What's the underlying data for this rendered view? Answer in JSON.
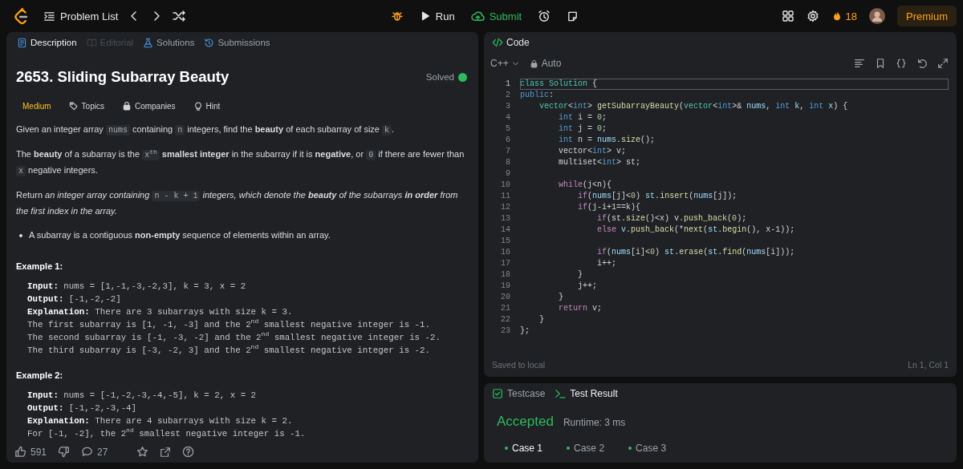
{
  "topbar": {
    "problem_list": "Problem List",
    "run": "Run",
    "submit": "Submit",
    "streak": "18",
    "premium": "Premium"
  },
  "description_tabs": [
    {
      "label": "Description",
      "selected": true,
      "disabled": false
    },
    {
      "label": "Editorial",
      "selected": false,
      "disabled": true
    },
    {
      "label": "Solutions",
      "selected": false,
      "disabled": false
    },
    {
      "label": "Submissions",
      "selected": false,
      "disabled": false
    }
  ],
  "problem": {
    "title": "2653. Sliding Subarray Beauty",
    "status": "Solved",
    "difficulty": "Medium",
    "tags": [
      "Topics",
      "Companies",
      "Hint"
    ],
    "paragraphs": [
      [
        {
          "kind": "text",
          "text": "Given an integer array "
        },
        {
          "kind": "code",
          "text": "nums"
        },
        {
          "kind": "text",
          "text": " containing "
        },
        {
          "kind": "code",
          "text": "n"
        },
        {
          "kind": "text",
          "text": " integers, find the **beauty** of each subarray of size "
        },
        {
          "kind": "code",
          "text": "k"
        },
        {
          "kind": "text",
          "text": "."
        }
      ],
      [
        {
          "kind": "text",
          "text": "The **beauty** of a subarray is the "
        },
        {
          "kind": "code",
          "text": "x$^{th}$"
        },
        {
          "kind": "text",
          "text": " **smallest integer** in the subarray if it is **negative**, or "
        },
        {
          "kind": "code",
          "text": "0"
        },
        {
          "kind": "text",
          "text": " if there are fewer than "
        },
        {
          "kind": "code",
          "text": "x"
        },
        {
          "kind": "text",
          "text": " negative integers."
        }
      ],
      [
        {
          "kind": "text",
          "text": "Return "
        },
        {
          "kind": "em",
          "text": "an integer array containing "
        },
        {
          "kind": "code",
          "text": "n - k + 1"
        },
        {
          "kind": "em",
          "text": " integers, which denote the **beauty** of the subarrays **in order** from the first index in the array."
        }
      ]
    ],
    "bullets": [
      "A subarray is a contiguous **non-empty** sequence of elements within an array."
    ],
    "examples": [
      {
        "title": "Example 1:",
        "lines": [
          "**Input:** nums = [1,-1,-3,-2,3], k = 3, x = 2",
          "**Output:** [-1,-2,-2]",
          "**Explanation:** There are 3 subarrays with size k = 3.",
          "The first subarray is [1, -1, -3] and the 2$^{nd}$ smallest negative integer is -1.",
          "The second subarray is [-1, -3, -2] and the 2$^{nd}$ smallest negative integer is -2.",
          "The third subarray is [-3, -2, 3] and the 2$^{nd}$ smallest negative integer is -2."
        ]
      },
      {
        "title": "Example 2:",
        "lines": [
          "**Input:** nums = [-1,-2,-3,-4,-5], k = 2, x = 2",
          "**Output:** [-1,-2,-3,-4]",
          "**Explanation:** There are 4 subarrays with size k = 2.",
          "For [-1, -2], the 2$^{nd}$ smallest negative integer is -1."
        ]
      }
    ],
    "likes": "591",
    "comments": "27"
  },
  "code": {
    "title": "Code",
    "language": "C++",
    "mode": "Auto",
    "saved": "Saved to local",
    "cursor": "Ln 1, Col 1",
    "lines": [
      {
        "no": "1",
        "current": true,
        "tokens": [
          {
            "text": "class Solution",
            "kind": "ty"
          },
          {
            "text": " {",
            "kind": "p"
          }
        ]
      },
      {
        "no": "2",
        "current": false,
        "tokens": [
          {
            "text": "public",
            "kind": "bt"
          },
          {
            "text": ":",
            "kind": "p"
          }
        ]
      },
      {
        "no": "3",
        "current": false,
        "tokens": [
          {
            "text": "    vector",
            "kind": "ty"
          },
          {
            "text": "<",
            "kind": "p"
          },
          {
            "text": "int",
            "kind": "bt"
          },
          {
            "text": "> ",
            "kind": "p"
          },
          {
            "text": "getSubarrayBeauty",
            "kind": "fn"
          },
          {
            "text": "(",
            "kind": "p"
          },
          {
            "text": "vector",
            "kind": "ty"
          },
          {
            "text": "<",
            "kind": "p"
          },
          {
            "text": "int",
            "kind": "bt"
          },
          {
            "text": ">& ",
            "kind": "p"
          },
          {
            "text": "nums",
            "kind": "var"
          },
          {
            "text": ", ",
            "kind": "p"
          },
          {
            "text": "int",
            "kind": "bt"
          },
          {
            "text": " k",
            "kind": "var"
          },
          {
            "text": ", ",
            "kind": "p"
          },
          {
            "text": "int",
            "kind": "bt"
          },
          {
            "text": " x",
            "kind": "var"
          },
          {
            "text": ") {",
            "kind": "p"
          }
        ]
      },
      {
        "no": "4",
        "current": false,
        "tokens": [
          {
            "text": "        int",
            "kind": "bt"
          },
          {
            "text": " i = ",
            "kind": "p"
          },
          {
            "text": "0",
            "kind": "num"
          },
          {
            "text": ";",
            "kind": "p"
          }
        ]
      },
      {
        "no": "5",
        "current": false,
        "tokens": [
          {
            "text": "        int",
            "kind": "bt"
          },
          {
            "text": " j = ",
            "kind": "p"
          },
          {
            "text": "0",
            "kind": "num"
          },
          {
            "text": ";",
            "kind": "p"
          }
        ]
      },
      {
        "no": "6",
        "current": false,
        "tokens": [
          {
            "text": "        int",
            "kind": "bt"
          },
          {
            "text": " n = ",
            "kind": "p"
          },
          {
            "text": "nums",
            "kind": "var"
          },
          {
            "text": ".",
            "kind": "p"
          },
          {
            "text": "size",
            "kind": "fn"
          },
          {
            "text": "();",
            "kind": "p"
          }
        ]
      },
      {
        "no": "7",
        "current": false,
        "tokens": [
          {
            "text": "        vector<",
            "kind": "p"
          },
          {
            "text": "int",
            "kind": "bt"
          },
          {
            "text": "> v;",
            "kind": "p"
          }
        ]
      },
      {
        "no": "8",
        "current": false,
        "tokens": [
          {
            "text": "        multiset<",
            "kind": "p"
          },
          {
            "text": "int",
            "kind": "bt"
          },
          {
            "text": "> st;",
            "kind": "p"
          }
        ]
      },
      {
        "no": "9",
        "current": false
      },
      {
        "no": "10",
        "current": false,
        "tokens": [
          {
            "text": "        while",
            "kind": "kw"
          },
          {
            "text": "(j<n){",
            "kind": "p"
          }
        ]
      },
      {
        "no": "11",
        "current": false,
        "tokens": [
          {
            "text": "            if",
            "kind": "kw"
          },
          {
            "text": "(",
            "kind": "p"
          },
          {
            "text": "nums",
            "kind": "var"
          },
          {
            "text": "[j]<",
            "kind": "p"
          },
          {
            "text": "0",
            "kind": "num"
          },
          {
            "text": ") ",
            "kind": "p"
          },
          {
            "text": "st",
            "kind": "var"
          },
          {
            "text": ".",
            "kind": "p"
          },
          {
            "text": "insert",
            "kind": "fn"
          },
          {
            "text": "(",
            "kind": "p"
          },
          {
            "text": "nums",
            "kind": "var"
          },
          {
            "text": "[j]);",
            "kind": "p"
          }
        ]
      },
      {
        "no": "12",
        "current": false,
        "tokens": [
          {
            "text": "            if",
            "kind": "kw"
          },
          {
            "text": "(j-i+1==k){",
            "kind": "p"
          }
        ]
      },
      {
        "no": "13",
        "current": false,
        "tokens": [
          {
            "text": "                if",
            "kind": "kw"
          },
          {
            "text": "(st.",
            "kind": "p"
          },
          {
            "text": "size",
            "kind": "fn"
          },
          {
            "text": "()<x) v.",
            "kind": "p"
          },
          {
            "text": "push_back",
            "kind": "fn"
          },
          {
            "text": "(",
            "kind": "p"
          },
          {
            "text": "0",
            "kind": "num"
          },
          {
            "text": ");",
            "kind": "p"
          }
        ]
      },
      {
        "no": "14",
        "current": false,
        "tokens": [
          {
            "text": "                else",
            "kind": "kw"
          },
          {
            "text": " v",
            "kind": "var"
          },
          {
            "text": ".",
            "kind": "p"
          },
          {
            "text": "push_back",
            "kind": "fn"
          },
          {
            "text": "(*",
            "kind": "p"
          },
          {
            "text": "next",
            "kind": "fn"
          },
          {
            "text": "(",
            "kind": "p"
          },
          {
            "text": "st",
            "kind": "var"
          },
          {
            "text": ".",
            "kind": "p"
          },
          {
            "text": "begin",
            "kind": "fn"
          },
          {
            "text": "(), x-1));",
            "kind": "p"
          }
        ]
      },
      {
        "no": "15",
        "current": false
      },
      {
        "no": "16",
        "current": false,
        "tokens": [
          {
            "text": "                if",
            "kind": "kw"
          },
          {
            "text": "(",
            "kind": "p"
          },
          {
            "text": "nums",
            "kind": "var"
          },
          {
            "text": "[i]<",
            "kind": "p"
          },
          {
            "text": "0",
            "kind": "num"
          },
          {
            "text": ") ",
            "kind": "p"
          },
          {
            "text": "st",
            "kind": "var"
          },
          {
            "text": ".",
            "kind": "p"
          },
          {
            "text": "erase",
            "kind": "fn"
          },
          {
            "text": "(",
            "kind": "p"
          },
          {
            "text": "st",
            "kind": "var"
          },
          {
            "text": ".",
            "kind": "p"
          },
          {
            "text": "find",
            "kind": "fn"
          },
          {
            "text": "(",
            "kind": "p"
          },
          {
            "text": "nums",
            "kind": "var"
          },
          {
            "text": "[i]));",
            "kind": "p"
          }
        ]
      },
      {
        "no": "17",
        "current": false,
        "tokens": [
          {
            "text": "                i++;",
            "kind": "p"
          }
        ]
      },
      {
        "no": "18",
        "current": false,
        "tokens": [
          {
            "text": "            }",
            "kind": "p"
          }
        ]
      },
      {
        "no": "19",
        "current": false,
        "tokens": [
          {
            "text": "            j++;",
            "kind": "p"
          }
        ]
      },
      {
        "no": "20",
        "current": false,
        "tokens": [
          {
            "text": "        }",
            "kind": "p"
          }
        ]
      },
      {
        "no": "21",
        "current": false,
        "tokens": [
          {
            "text": "        return",
            "kind": "kw"
          },
          {
            "text": " v;",
            "kind": "p"
          }
        ]
      },
      {
        "no": "22",
        "current": false,
        "tokens": [
          {
            "text": "    }",
            "kind": "p"
          }
        ]
      },
      {
        "no": "23",
        "current": false,
        "tokens": [
          {
            "text": "};",
            "kind": "p"
          }
        ]
      }
    ]
  },
  "result": {
    "tabs": [
      {
        "label": "Testcase",
        "selected": false
      },
      {
        "label": "Test Result",
        "selected": true
      }
    ],
    "verdict": "Accepted",
    "runtime": "Runtime: 3 ms",
    "cases": [
      {
        "label": "Case 1",
        "selected": true
      },
      {
        "label": "Case 2",
        "selected": false
      },
      {
        "label": "Case 3",
        "selected": false
      }
    ]
  }
}
